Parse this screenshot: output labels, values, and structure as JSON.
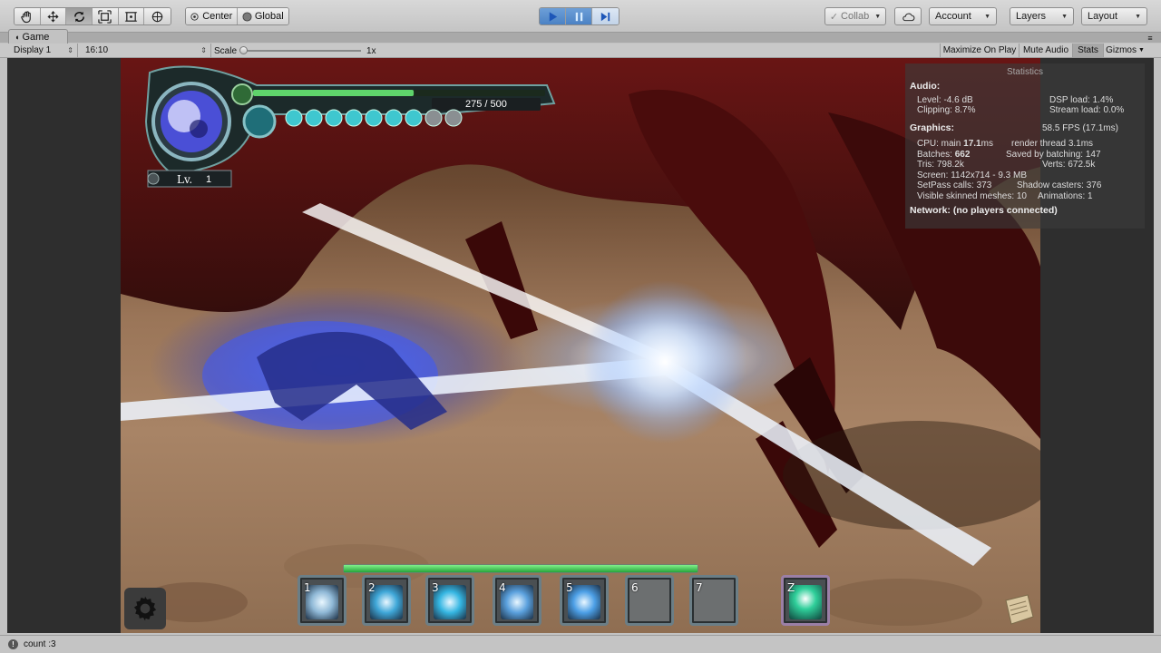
{
  "toolbar": {
    "tools": [
      "hand-icon",
      "move-icon",
      "rotate-icon",
      "scale-icon",
      "rect-icon",
      "transform-icon"
    ],
    "pivot_mode": "Center",
    "pivot_rotation": "Global",
    "play_state": "paused",
    "collab": "Collab",
    "account": "Account",
    "layers": "Layers",
    "layout": "Layout"
  },
  "game_tab": {
    "title": "Game"
  },
  "game_bar": {
    "display": "Display 1",
    "aspect": "16:10",
    "scale_label": "Scale",
    "scale_value": "1x",
    "maximize_on_play": "Maximize On Play",
    "mute_audio": "Mute Audio",
    "stats": "Stats",
    "gizmos": "Gizmos"
  },
  "stats": {
    "title": "Statistics",
    "audio_heading": "Audio:",
    "level": "Level: -4.6 dB",
    "dsp_load": "DSP load: 1.4%",
    "clipping": "Clipping: 8.7%",
    "stream_load": "Stream load: 0.0%",
    "graphics_heading": "Graphics:",
    "fps": "58.5 FPS (17.1ms)",
    "cpu_main_prefix": "CPU: main",
    "cpu_main_value": "17.1",
    "cpu_main_suffix": "ms",
    "render_thread": "render thread 3.1ms",
    "batches_prefix": "Batches:",
    "batches_value": "662",
    "saved_by_batching": "Saved by batching: 147",
    "tris": "Tris: 798.2k",
    "verts": "Verts: 672.5k",
    "screen": "Screen: 1142x714 - 9.3 MB",
    "setpass": "SetPass calls: 373",
    "shadow_casters": "Shadow casters: 376",
    "skinned": "Visible skinned meshes: 10",
    "animations": "Animations: 1",
    "network": "Network: (no players connected)"
  },
  "player_hud": {
    "hp_text": "275 / 500",
    "hp_fraction": 0.55,
    "level_label": "Lv.",
    "level_value": "1",
    "orbs_filled": 7,
    "orbs_total": 9
  },
  "skills": {
    "slots": [
      {
        "num": "1",
        "filled": true
      },
      {
        "num": "2",
        "filled": true
      },
      {
        "num": "3",
        "filled": true
      },
      {
        "num": "4",
        "filled": true
      },
      {
        "num": "5",
        "filled": true
      },
      {
        "num": "6",
        "filled": false
      },
      {
        "num": "7",
        "filled": false
      }
    ],
    "special": {
      "num": "Z",
      "filled": true
    },
    "bar_fraction": 1.0
  },
  "status": {
    "text": "count :3"
  },
  "colors": {
    "play_accent": "#4b82c4",
    "hp_green": "#5fd46b",
    "orb_cyan": "#3fc7cf"
  }
}
